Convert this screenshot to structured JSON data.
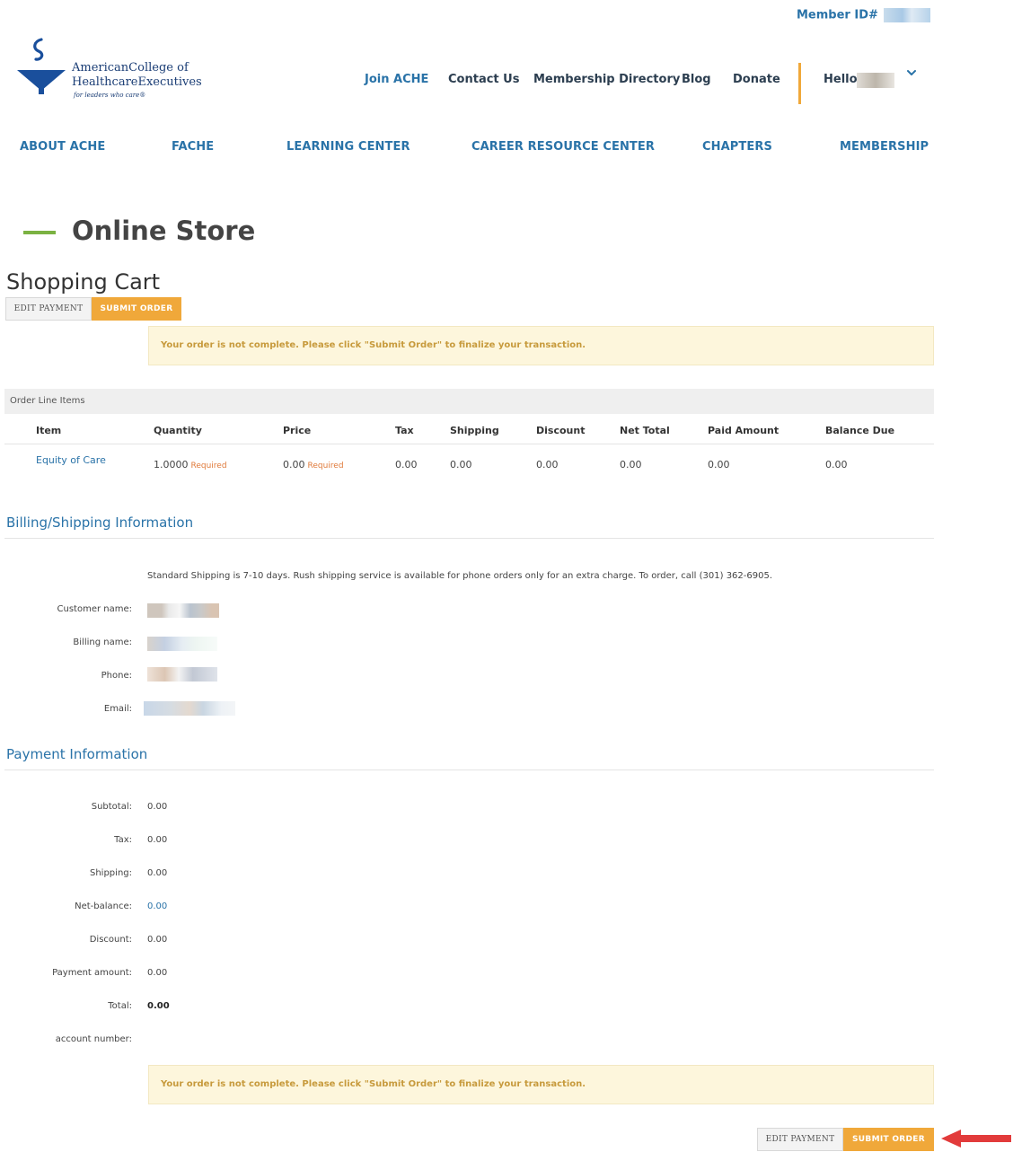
{
  "header": {
    "member_id_label": "Member ID#",
    "logo": {
      "line1": "AmericanCollege of",
      "line2": "HealthcareExecutives",
      "tagline": "for leaders who care®"
    },
    "util_nav": [
      "Join ACHE",
      "Contact Us",
      "Membership Directory",
      "Blog",
      "Donate"
    ],
    "greeting": "Hello,",
    "main_nav": [
      "ABOUT ACHE",
      "FACHE",
      "LEARNING CENTER",
      "CAREER RESOURCE CENTER",
      "CHAPTERS",
      "MEMBERSHIP"
    ]
  },
  "page": {
    "title": "Online Store",
    "cart_title": "Shopping Cart"
  },
  "buttons": {
    "edit_payment": "EDIT PAYMENT",
    "submit_order": "SUBMIT ORDER"
  },
  "alert_text": "Your order is not complete. Please click \"Submit Order\" to finalize your transaction.",
  "table": {
    "heading": "Order Line Items",
    "columns": [
      "Item",
      "Quantity",
      "Price",
      "Tax",
      "Shipping",
      "Discount",
      "Net Total",
      "Paid Amount",
      "Balance Due"
    ],
    "row": {
      "item": "Equity of Care",
      "quantity": "1.0000",
      "price": "0.00",
      "required": "Required",
      "tax": "0.00",
      "shipping": "0.00",
      "discount": "0.00",
      "net_total": "0.00",
      "paid_amount": "0.00",
      "balance_due": "0.00"
    }
  },
  "billing": {
    "title": "Billing/Shipping Information",
    "note": "Standard Shipping is 7-10 days. Rush shipping service is available for phone orders only for an extra charge. To order, call (301) 362-6905.",
    "labels": {
      "customer_name": "Customer name:",
      "billing_name": "Billing name:",
      "phone": "Phone:",
      "email": "Email:"
    }
  },
  "payment": {
    "title": "Payment Information",
    "subtotal_label": "Subtotal:",
    "subtotal": "0.00",
    "tax_label": "Tax:",
    "tax": "0.00",
    "shipping_label": "Shipping:",
    "shipping": "0.00",
    "net_balance_label": "Net-balance:",
    "net_balance": "0.00",
    "discount_label": "Discount:",
    "discount": "0.00",
    "payment_amount_label": "Payment amount:",
    "payment_amount": "0.00",
    "total_label": "Total:",
    "total": "0.00",
    "account_number_label": "account number:"
  },
  "colors": {
    "brand_blue": "#2a73a8",
    "accent_orange": "#f0a83a",
    "accent_green": "#7bb242",
    "alert_bg": "#fdf6dc",
    "alert_text": "#c79a3c",
    "required_text": "#e07a3a",
    "arrow_red": "#e23b3b"
  }
}
